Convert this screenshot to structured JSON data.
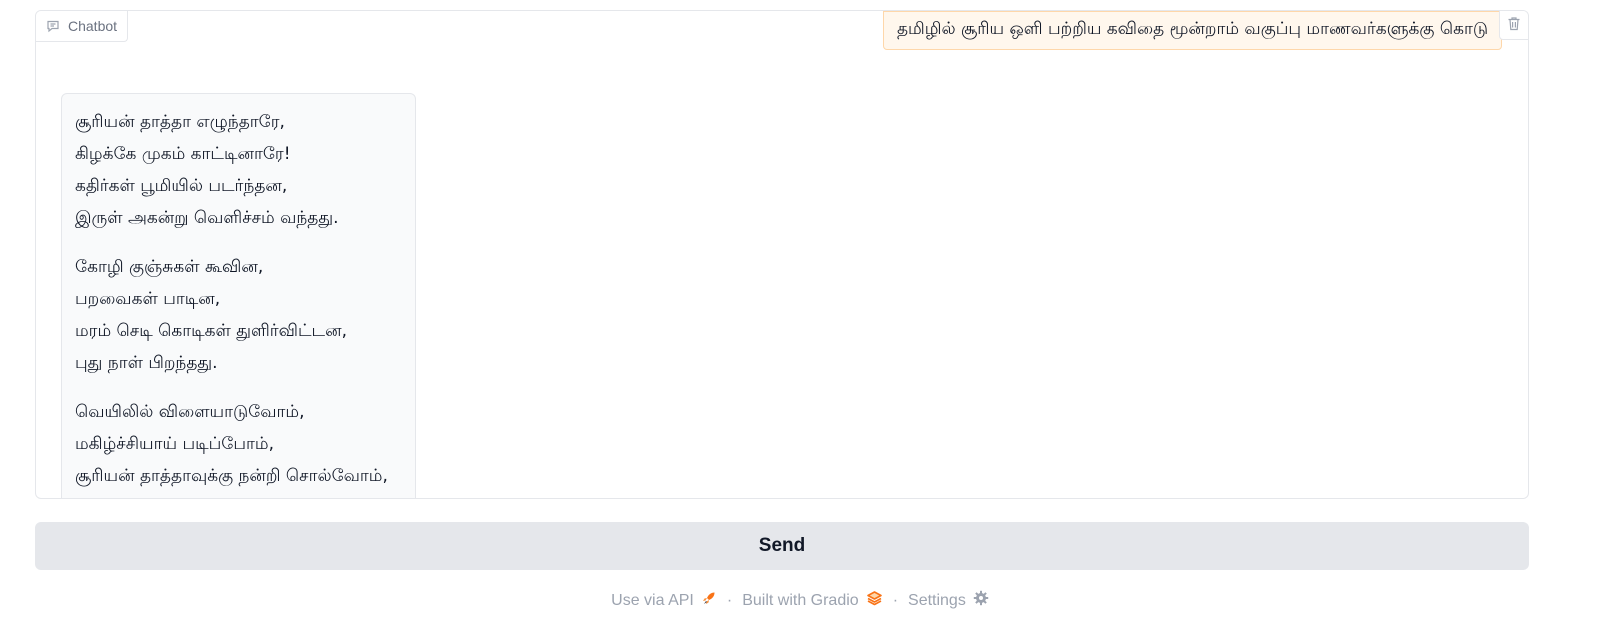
{
  "chatbot": {
    "label": "Chatbot",
    "label_icon": "chat-icon",
    "clear_icon": "trash-icon",
    "user_message": "தமிழில் சூரிய ஒளி பற்றிய கவிதை மூன்றாம் வகுப்பு மாணவர்களுக்கு கொடு",
    "bot_message": {
      "stanzas": [
        [
          "சூரியன் தாத்தா எழுந்தாரே,",
          "கிழக்கே முகம் காட்டினாரே!",
          "கதிர்கள் பூமியில் படர்ந்தன,",
          "இருள் அகன்று வெளிச்சம் வந்தது."
        ],
        [
          "கோழி குஞ்சுகள் கூவின,",
          "பறவைகள் பாடின,",
          "மரம் செடி கொடிகள் துளிர்விட்டன,",
          "புது நாள் பிறந்தது."
        ],
        [
          "வெயிலில் விளையாடுவோம்,",
          "மகிழ்ச்சியாய் படிப்போம்,",
          "சூரியன் தாத்தாவுக்கு நன்றி சொல்வோம்,"
        ]
      ]
    }
  },
  "send_button": {
    "label": "Send"
  },
  "footer": {
    "api_label": "Use via API",
    "api_icon": "rocket-icon",
    "built_label": "Built with Gradio",
    "built_icon": "gradio-logo-icon",
    "settings_label": "Settings",
    "settings_icon": "gear-icon",
    "separator": "·"
  },
  "colors": {
    "user_bubble_bg": "#fff7ed",
    "user_bubble_border": "#fed7aa",
    "bot_bubble_bg": "#f9fafb",
    "send_bg": "#e5e7eb",
    "gradio_orange": "#f97316"
  }
}
